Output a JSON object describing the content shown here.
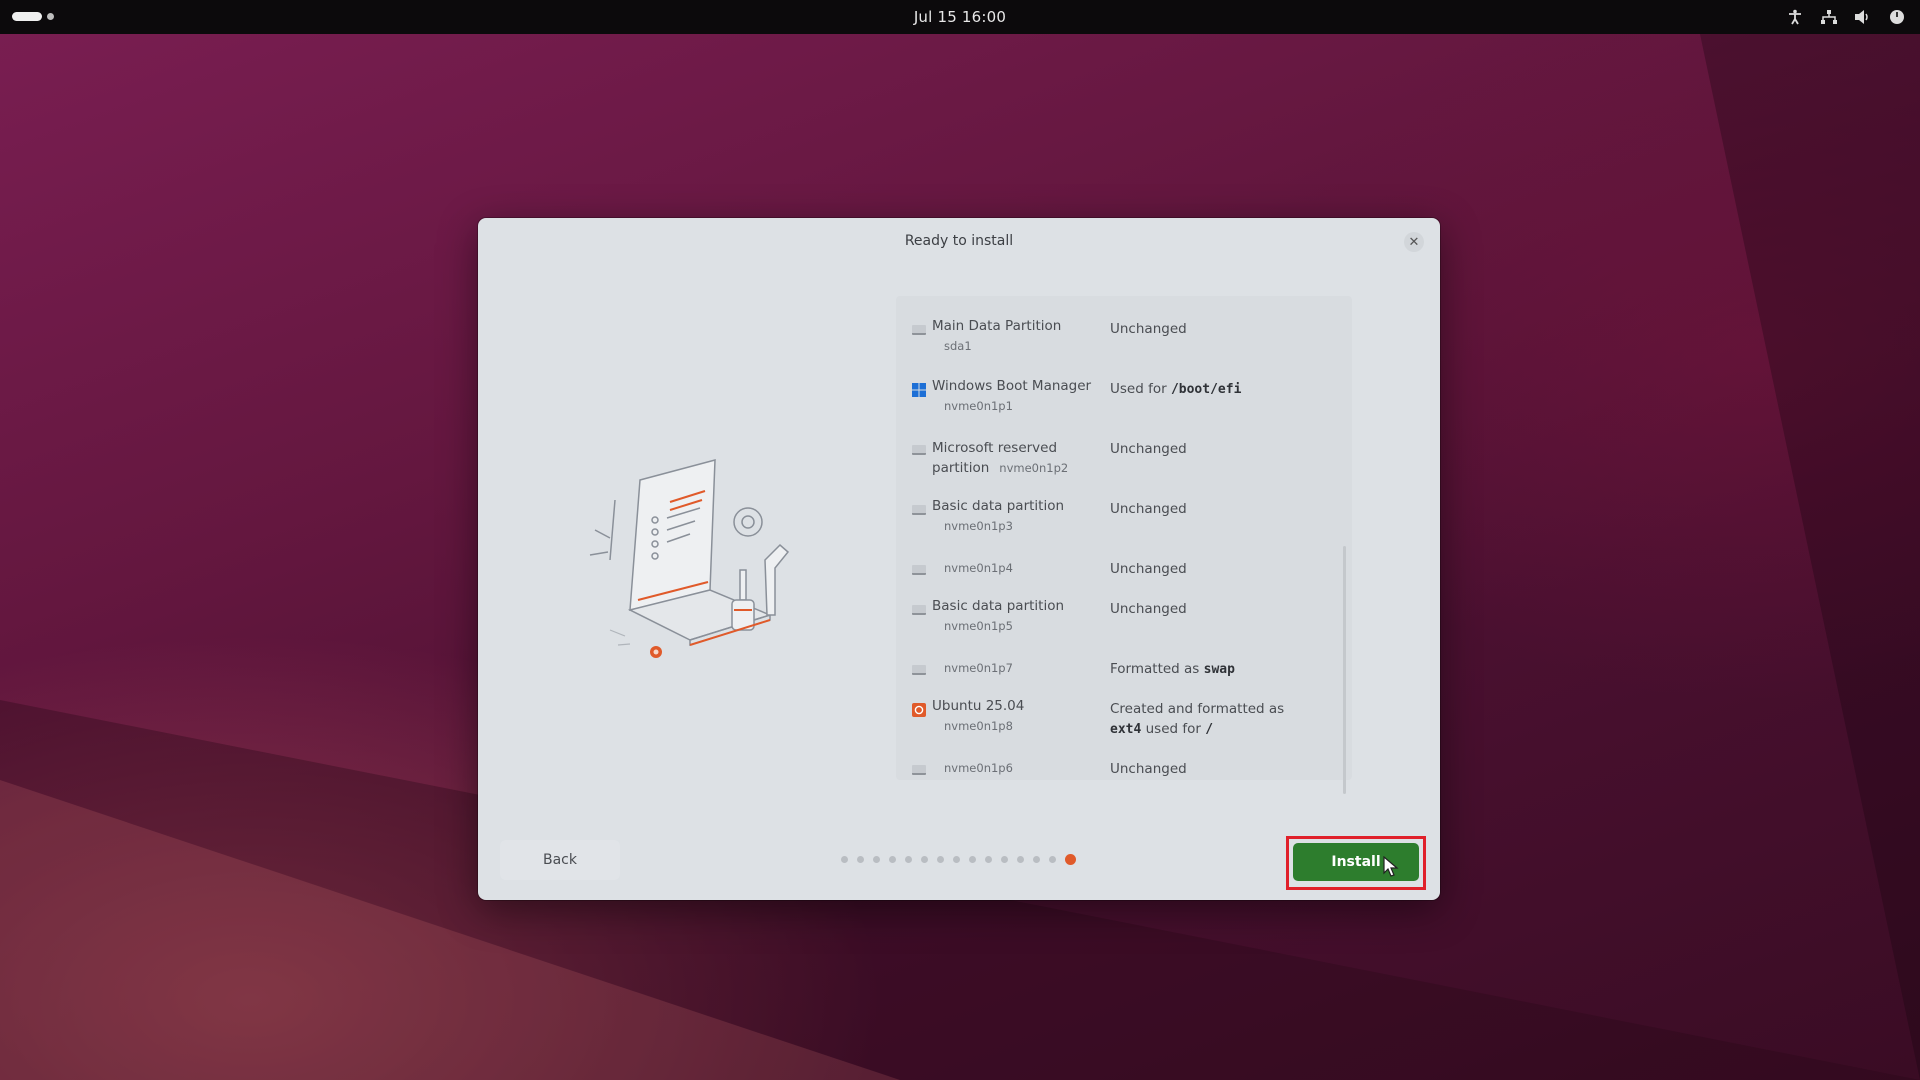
{
  "topbar": {
    "clock": "Jul 15  16:00",
    "tray_icons": [
      "accessibility-icon",
      "network-icon",
      "volume-icon",
      "power-icon"
    ]
  },
  "dialog": {
    "title": "Ready to install",
    "close_icon": "close-icon",
    "partitions": [
      {
        "name": "Main Data Partition",
        "device": "sda1",
        "action": "Unchanged",
        "icon": "disk-icon"
      },
      {
        "name": "Windows Boot Manager",
        "device": "nvme0n1p1",
        "action_prefix": "Used for",
        "action_value": "/boot/efi",
        "icon": "windows-icon"
      },
      {
        "name": "Microsoft reserved partition",
        "name_line1": "Microsoft reserved",
        "name_line2": "partition",
        "device": "nvme0n1p2",
        "action": "Unchanged",
        "icon": "disk-icon"
      },
      {
        "name": "Basic data partition",
        "device": "nvme0n1p3",
        "action": "Unchanged",
        "icon": "disk-icon"
      },
      {
        "name": "",
        "device": "nvme0n1p4",
        "action": "Unchanged",
        "icon": "disk-icon"
      },
      {
        "name": "Basic data partition",
        "device": "nvme0n1p5",
        "action": "Unchanged",
        "icon": "disk-icon"
      },
      {
        "name": "",
        "device": "nvme0n1p7",
        "action_prefix": "Formatted as",
        "action_value": "swap",
        "icon": "disk-icon"
      },
      {
        "name": "Ubuntu 25.04",
        "device": "nvme0n1p8",
        "action_line1": "Created and formatted as",
        "action_value": "ext4",
        "action_mid": "used for",
        "action_value2": "/",
        "icon": "ubuntu-icon"
      },
      {
        "name": "",
        "device": "nvme0n1p6",
        "action": "Unchanged",
        "icon": "disk-icon"
      }
    ],
    "back_label": "Back",
    "install_label": "Install",
    "pager": {
      "total": 15,
      "current": 15
    },
    "colors": {
      "accent": "#e05a2a",
      "install": "#2d7d2d",
      "highlight": "#e0202a"
    }
  }
}
